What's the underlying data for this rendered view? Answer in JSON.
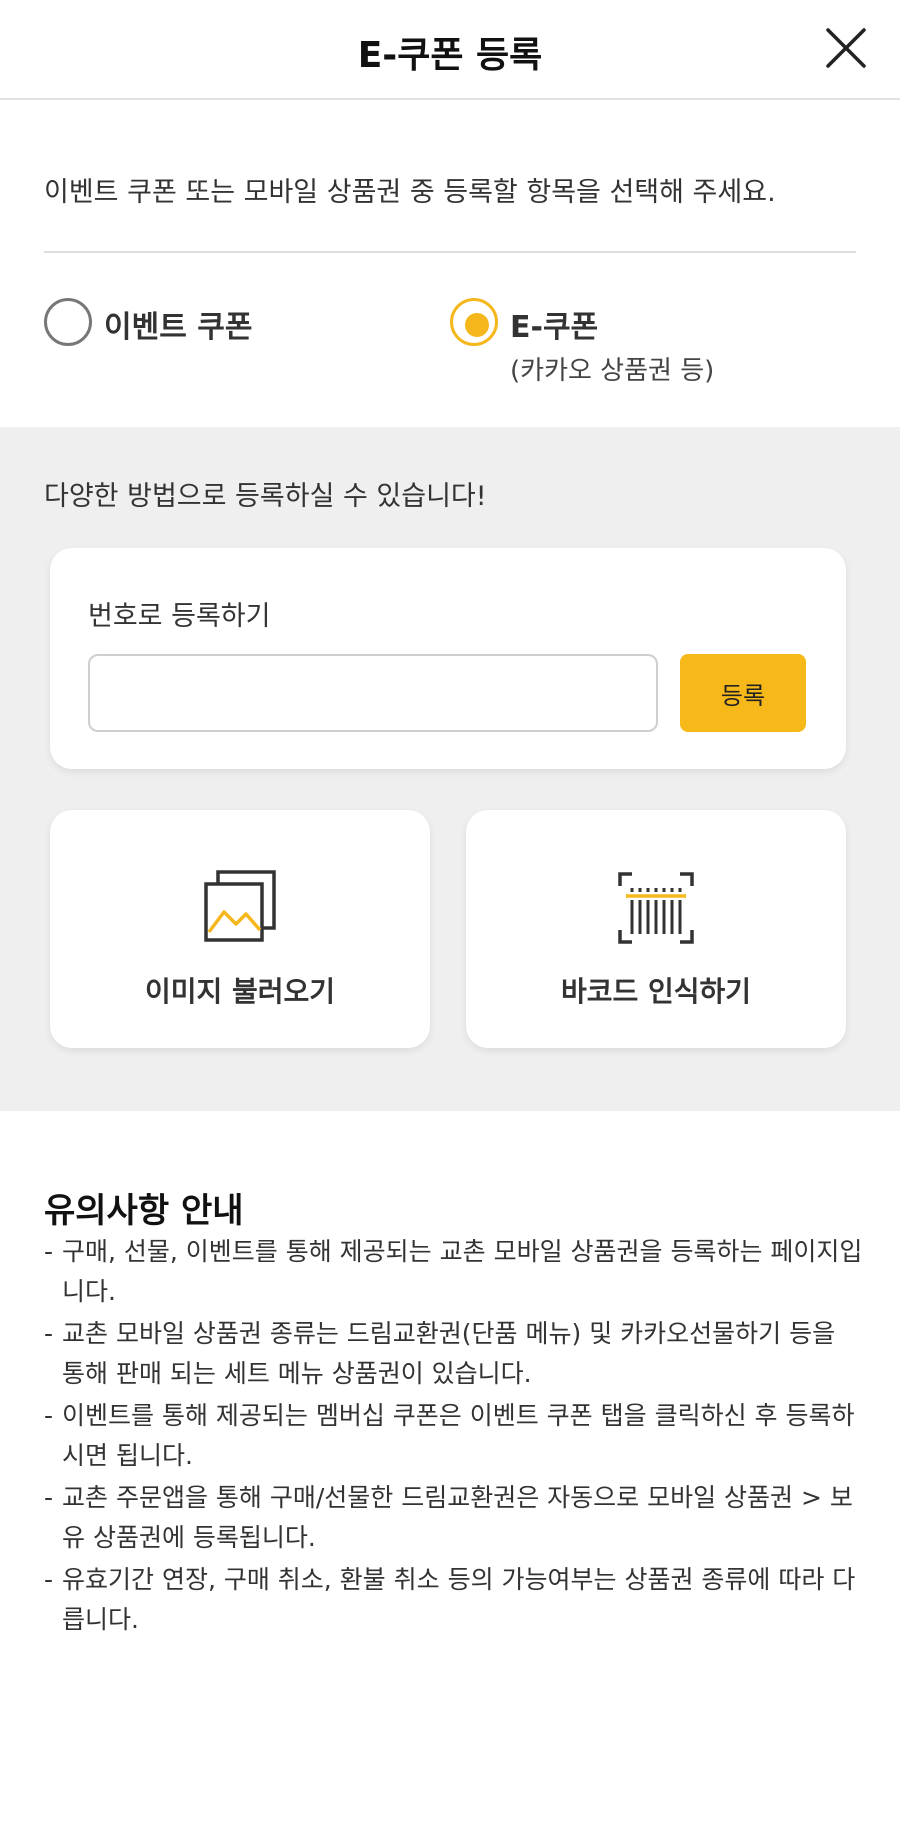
{
  "header": {
    "title": "E-쿠폰 등록",
    "close_icon": "close-icon"
  },
  "intro": {
    "text": "이벤트 쿠폰 또는 모바일 상품권 중 등록할 항목을 선택해 주세요."
  },
  "options": {
    "event": {
      "label": "이벤트 쿠폰",
      "selected": false
    },
    "ecoupon": {
      "label": "E-쿠폰",
      "sub": "(카카오 상품권 등)",
      "selected": true
    }
  },
  "methods": {
    "caption": "다양한 방법으로 등록하실 수 있습니다!",
    "number": {
      "title": "번호로 등록하기",
      "input_value": "",
      "button_label": "등록"
    },
    "image": {
      "label": "이미지 불러오기",
      "icon": "image-gallery-icon"
    },
    "barcode": {
      "label": "바코드 인식하기",
      "icon": "barcode-scan-icon"
    }
  },
  "notice": {
    "title": "유의사항 안내",
    "items": [
      "구매, 선물, 이벤트를 통해 제공되는 교촌 모바일 상품권을 등록하는 페이지입니다.",
      "교촌 모바일 상품권 종류는 드림교환권(단품 메뉴) 및 카카오선물하기 등을 통해 판매 되는 세트 메뉴 상품권이 있습니다.",
      "이벤트를 통해 제공되는 멤버십 쿠폰은 이벤트 쿠폰 탭을 클릭하신 후 등록하시면 됩니다.",
      "교촌 주문앱을 통해 구매/선물한 드림교환권은 자동으로 모바일 상품권 > 보유 상품권에 등록됩니다.",
      "유효기간 연장, 구매 취소, 환불 취소 등의 가능여부는 상품권 종류에 따라 다릅니다."
    ]
  },
  "colors": {
    "accent": "#f7b91a",
    "panel_bg": "#efefef"
  }
}
